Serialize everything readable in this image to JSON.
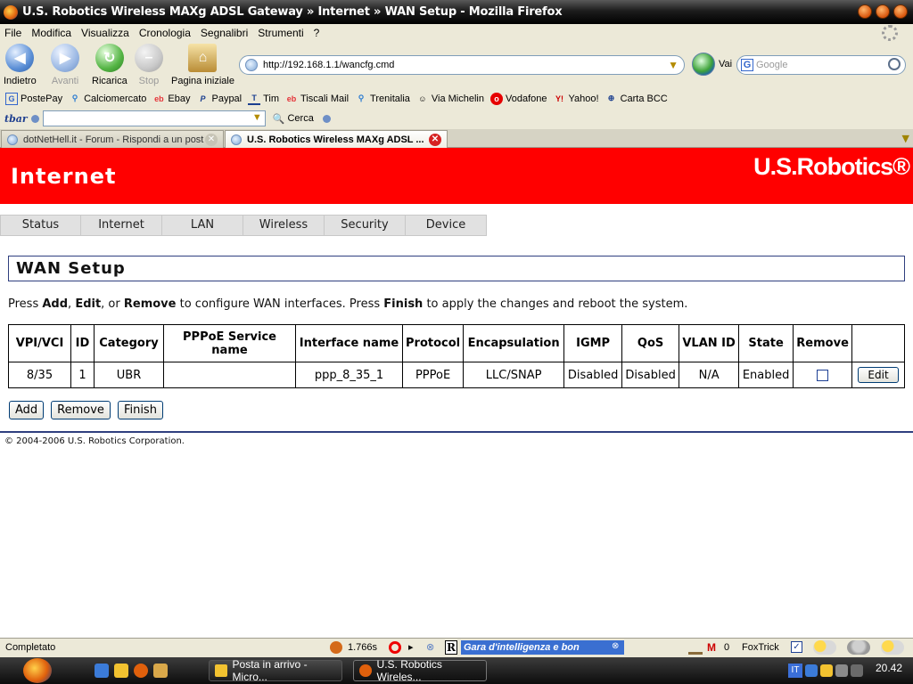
{
  "window": {
    "title": "U.S. Robotics Wireless MAXg ADSL Gateway » Internet » WAN Setup - Mozilla Firefox"
  },
  "menu": [
    "File",
    "Modifica",
    "Visualizza",
    "Cronologia",
    "Segnalibri",
    "Strumenti",
    "?"
  ],
  "nav": {
    "back_label": "Indietro",
    "forward_label": "Avanti",
    "reload_label": "Ricarica",
    "stop_label": "Stop",
    "home_label": "Pagina iniziale",
    "url": "http://192.168.1.1/wancfg.cmd",
    "go_label": "Vai",
    "search_placeholder": "Google"
  },
  "bookmarks": [
    "PostePay",
    "Calciomercato",
    "Ebay",
    "Paypal",
    "Tim",
    "Tiscali Mail",
    "Trenitalia",
    "Via Michelin",
    "Vodafone",
    "Yahoo!",
    "Carta BCC"
  ],
  "tbar": {
    "logo": "tbar",
    "search_label": "Cerca"
  },
  "tabs": [
    {
      "label": "dotNetHell.it - Forum - Rispondi a un post"
    },
    {
      "label": "U.S. Robotics Wireless MAXg ADSL ..."
    }
  ],
  "page": {
    "banner_title": "Internet",
    "logo": "U.S.Robotics®",
    "router_tabs": [
      "Status",
      "Internet",
      "LAN",
      "Wireless",
      "Security",
      "Device"
    ],
    "section_title": "WAN Setup",
    "instructions": {
      "p1": "Press ",
      "add": "Add",
      "p2": ", ",
      "edit": "Edit",
      "p3": ", or ",
      "remove": "Remove",
      "p4": " to configure WAN interfaces. Press ",
      "finish": "Finish",
      "p5": " to apply the changes and reboot the system."
    },
    "table": {
      "headers": [
        "VPI/VCI",
        "ID",
        "Category",
        "PPPoE Service name",
        "Interface name",
        "Protocol",
        "Encapsulation",
        "IGMP",
        "QoS",
        "VLAN ID",
        "State",
        "Remove",
        ""
      ],
      "rows": [
        {
          "vpi_vci": "8/35",
          "id": "1",
          "category": "UBR",
          "pppoe_service": "",
          "interface": "ppp_8_35_1",
          "protocol": "PPPoE",
          "encapsulation": "LLC/SNAP",
          "igmp": "Disabled",
          "qos": "Disabled",
          "vlan_id": "N/A",
          "state": "Enabled",
          "remove_checked": false,
          "edit_label": "Edit"
        }
      ]
    },
    "buttons": {
      "add": "Add",
      "remove": "Remove",
      "finish": "Finish"
    },
    "copyright": "© 2004-2006 U.S. Robotics Corporation."
  },
  "status": {
    "text": "Completato",
    "timer": "1.766s",
    "ticker": "Gara d'intelligenza e bon",
    "mail_count": "0",
    "foxtrick": "FoxTrick"
  },
  "taskbar": {
    "items": [
      {
        "label": "Posta in arrivo - Micro..."
      },
      {
        "label": "U.S. Robotics Wireles..."
      }
    ],
    "language": "IT",
    "clock": "20.42"
  },
  "colors": {
    "banner": "#ff0000",
    "title_border": "#2f3f7f"
  }
}
